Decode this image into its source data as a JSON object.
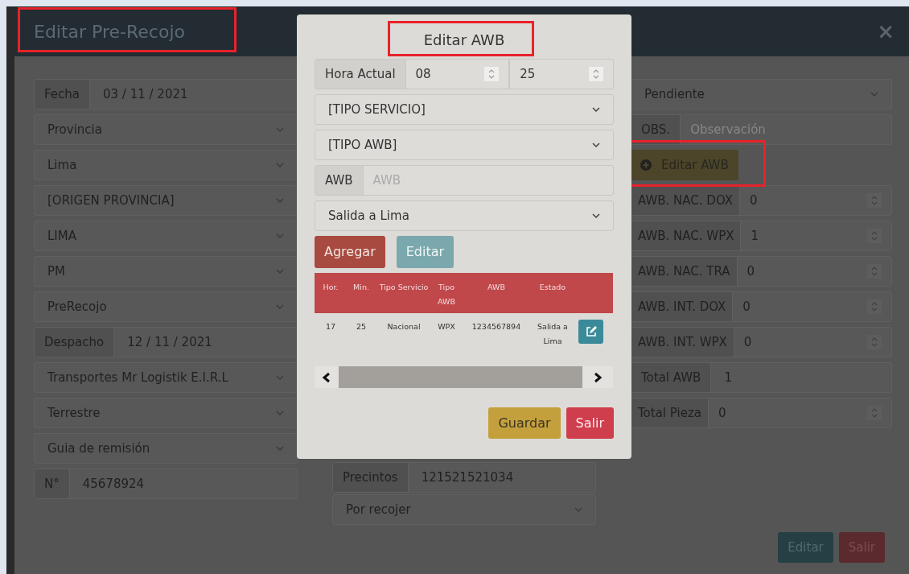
{
  "window": {
    "title": "Editar Pre-Recojo",
    "close": "×"
  },
  "left_fields": [
    {
      "kind": "addon",
      "label": "Fecha",
      "value": "03 / 11 / 2021"
    },
    {
      "kind": "select",
      "value": "Provincia"
    },
    {
      "kind": "select",
      "value": "Lima"
    },
    {
      "kind": "select",
      "value": "[ORIGEN PROVINCIA]"
    },
    {
      "kind": "select",
      "value": "LIMA"
    },
    {
      "kind": "select",
      "value": "PM"
    },
    {
      "kind": "select",
      "value": "PreRecojo"
    },
    {
      "kind": "addon",
      "label": "Despacho",
      "value": "12 / 11 / 2021"
    },
    {
      "kind": "select",
      "value": "Transportes Mr Logistik E.I.R.L"
    },
    {
      "kind": "select",
      "value": "Terrestre"
    },
    {
      "kind": "select",
      "value": "Guia de remisión"
    },
    {
      "kind": "addon",
      "label": "N°",
      "value": "45678924"
    }
  ],
  "middle_fields": [
    {
      "kind": "addon",
      "label": "Precintos",
      "value": "121521521034"
    },
    {
      "kind": "select",
      "value": "Por recojer"
    }
  ],
  "right_fields": [
    {
      "kind": "select",
      "value": "Pendiente"
    },
    {
      "kind": "addon",
      "label": "OBS.",
      "placeholder": "Observación"
    },
    {
      "kind": "button",
      "label": "Editar AWB"
    },
    {
      "kind": "spin",
      "label": "AWB. NAC. DOX",
      "value": "0"
    },
    {
      "kind": "spin",
      "label": "AWB. NAC. WPX",
      "value": "1"
    },
    {
      "kind": "spin",
      "label": "AWB. NAC. TRA",
      "value": "0"
    },
    {
      "kind": "spin",
      "label": "AWB. INT. DOX",
      "value": "0"
    },
    {
      "kind": "spin",
      "label": "AWB. INT. WPX",
      "value": "0"
    },
    {
      "kind": "addon",
      "label": "Total AWB",
      "value": "1"
    },
    {
      "kind": "spin",
      "label": "Total Pieza",
      "value": "0"
    }
  ],
  "footer_buttons": [
    {
      "kind": "primary",
      "label": "Editar"
    },
    {
      "kind": "danger",
      "label": "Salir"
    }
  ],
  "modal": {
    "title": "Editar AWB",
    "fields": [
      {
        "kind": "time",
        "label": "Hora Actual",
        "hour": "08",
        "minute": "25"
      },
      {
        "kind": "select",
        "value": "[TIPO SERVICIO]"
      },
      {
        "kind": "select",
        "value": "[TIPO AWB]"
      },
      {
        "kind": "addon",
        "label": "AWB",
        "placeholder": "AWB"
      },
      {
        "kind": "select",
        "value": "Salida a Lima"
      }
    ],
    "actions": [
      {
        "kind": "danger",
        "label": "Agregar"
      },
      {
        "kind": "info",
        "label": "Editar"
      }
    ],
    "table": {
      "columns": [
        "Hor.",
        "Min.",
        "Tipo Servicio",
        "Tipo AWB",
        "AWB",
        "Estado"
      ],
      "rows": [
        [
          "17",
          "25",
          "Nacional",
          "WPX",
          "1234567894",
          "Salida a Lima"
        ]
      ]
    },
    "footer_buttons": [
      {
        "kind": "warning",
        "label": "Guardar"
      },
      {
        "kind": "danger",
        "label": "Salir"
      }
    ]
  }
}
